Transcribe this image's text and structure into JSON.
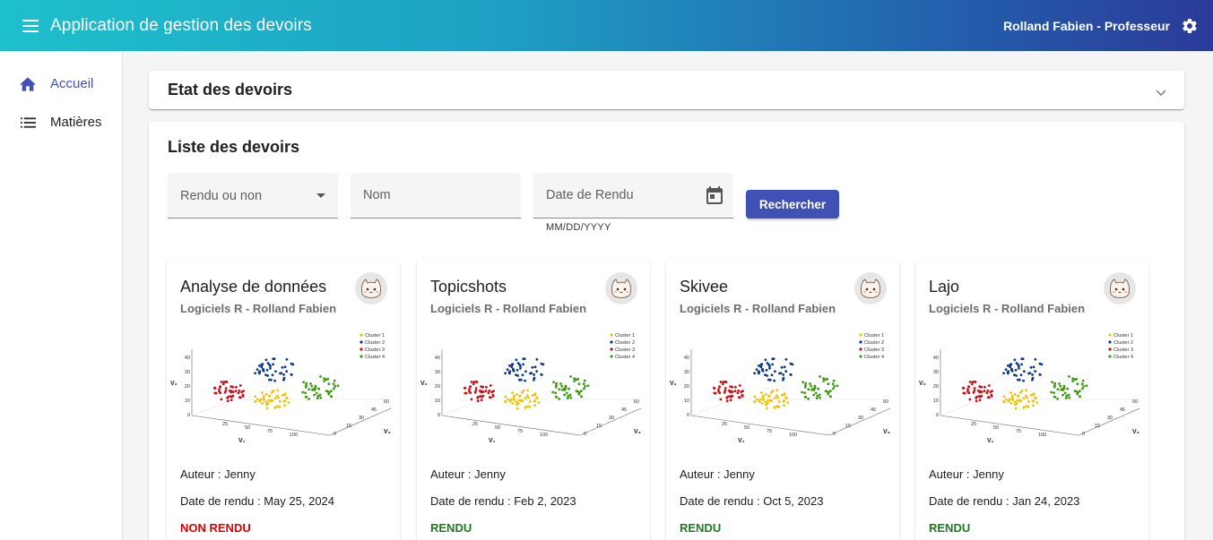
{
  "toolbar": {
    "title": "Application de gestion des devoirs",
    "user": "Rolland Fabien - Professeur",
    "menu_icon": "menu-icon",
    "settings_icon": "gear-icon"
  },
  "sidebar": {
    "items": [
      {
        "label": "Accueil",
        "icon": "home-icon",
        "active": true
      },
      {
        "label": "Matières",
        "icon": "list-icon",
        "active": false
      }
    ]
  },
  "state_panel": {
    "title": "Etat des devoirs"
  },
  "list_panel": {
    "title": "Liste des devoirs",
    "filters": {
      "rendu_select": "Rendu ou non",
      "nom_placeholder": "Nom",
      "date_placeholder": "Date de Rendu",
      "date_hint": "MM/DD/YYYY"
    },
    "search_label": "Rechercher"
  },
  "colors": {
    "accent": "#3f51b5",
    "rendu": "#1f7a1f",
    "non_rendu": "#e00000"
  },
  "cards": [
    {
      "title": "Analyse de données",
      "subtitle": "Logiciels R - Rolland Fabien",
      "author": "Auteur : Jenny",
      "date": "Date de rendu : May 25, 2024",
      "status": "NON RENDU",
      "rendu": false
    },
    {
      "title": "Topicshots",
      "subtitle": "Logiciels R - Rolland Fabien",
      "author": "Auteur : Jenny",
      "date": "Date de rendu : Feb 2, 2023",
      "status": "RENDU",
      "rendu": true
    },
    {
      "title": "Skivee",
      "subtitle": "Logiciels R - Rolland Fabien",
      "author": "Auteur : Jenny",
      "date": "Date de rendu : Oct 5, 2023",
      "status": "RENDU",
      "rendu": true
    },
    {
      "title": "Lajo",
      "subtitle": "Logiciels R - Rolland Fabien",
      "author": "Auteur : Jenny",
      "date": "Date de rendu : Jan 24, 2023",
      "status": "RENDU",
      "rendu": true
    }
  ],
  "card_image": {
    "legend": [
      "Cluster 1",
      "Cluster 2",
      "Cluster 3",
      "Cluster 4"
    ],
    "legend_colors": [
      "#f2c200",
      "#0d3a86",
      "#c8101a",
      "#3e9a12"
    ],
    "y_ticks": [
      "0",
      "10",
      "20",
      "30",
      "40"
    ],
    "x_ticks": [
      "25",
      "50",
      "75",
      "100"
    ],
    "z_ticks": [
      "0",
      "15",
      "30",
      "45",
      "60"
    ],
    "y_label": "V₂",
    "x_label": "V₁",
    "z_label": "V₃"
  }
}
